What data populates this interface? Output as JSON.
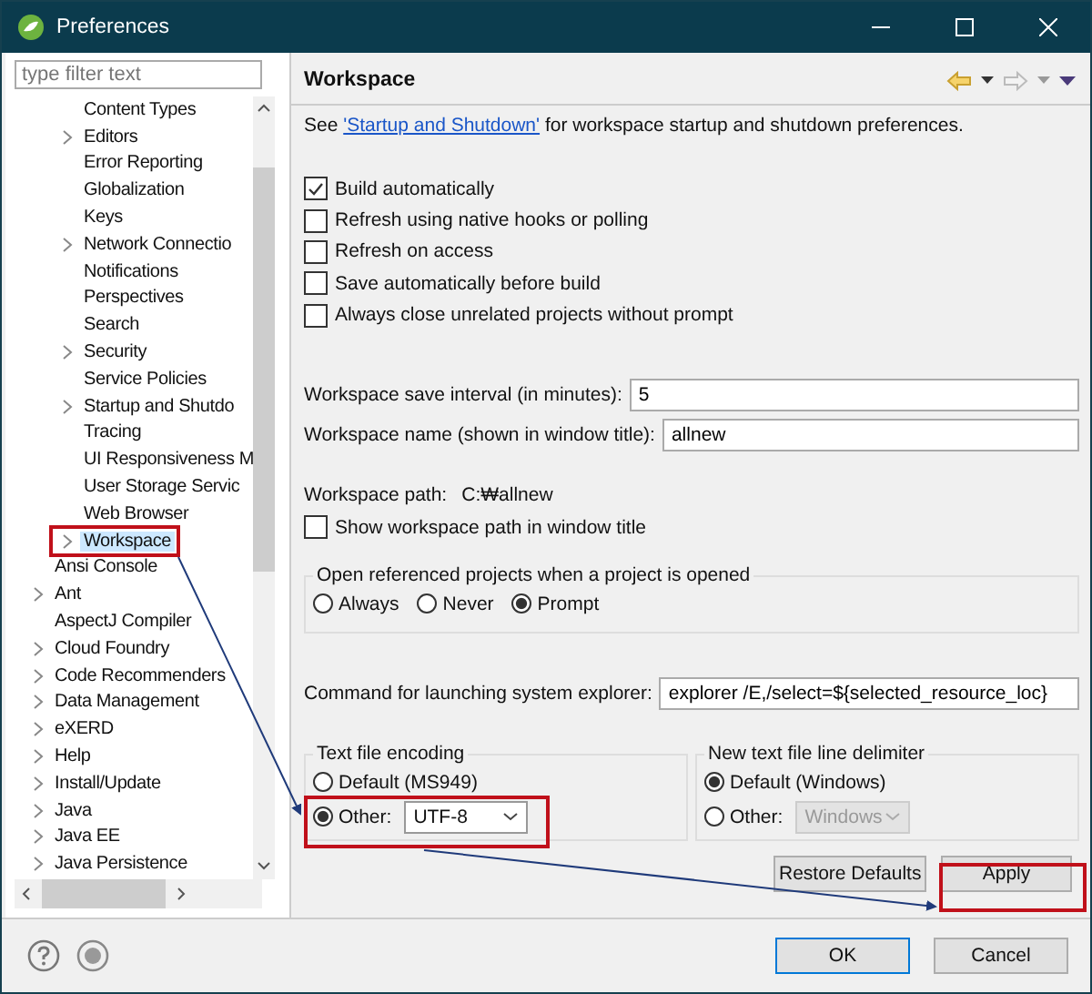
{
  "window": {
    "title": "Preferences"
  },
  "filter": {
    "placeholder": "type filter text"
  },
  "tree": [
    {
      "children": [
        {
          "label": "Content Types",
          "expandable": false,
          "selected": false
        },
        {
          "label": "Editors",
          "expandable": true,
          "selected": false
        },
        {
          "label": "Error Reporting",
          "expandable": false,
          "selected": false
        },
        {
          "label": "Globalization",
          "expandable": false,
          "selected": false
        },
        {
          "label": "Keys",
          "expandable": false,
          "selected": false
        },
        {
          "label": "Network Connectio",
          "expandable": true,
          "selected": false
        },
        {
          "label": "Notifications",
          "expandable": false,
          "selected": false
        },
        {
          "label": "Perspectives",
          "expandable": false,
          "selected": false
        },
        {
          "label": "Search",
          "expandable": false,
          "selected": false
        },
        {
          "label": "Security",
          "expandable": true,
          "selected": false
        },
        {
          "label": "Service Policies",
          "expandable": false,
          "selected": false
        },
        {
          "label": "Startup and Shutdo",
          "expandable": true,
          "selected": false
        },
        {
          "label": "Tracing",
          "expandable": false,
          "selected": false
        },
        {
          "label": "UI Responsiveness M",
          "expandable": false,
          "selected": false
        },
        {
          "label": "User Storage Servic",
          "expandable": false,
          "selected": false
        },
        {
          "label": "Web Browser",
          "expandable": false,
          "selected": false
        },
        {
          "label": "Workspace",
          "expandable": true,
          "selected": true
        }
      ]
    },
    {
      "label": "Ansi Console",
      "expandable": false,
      "selected": false
    },
    {
      "label": "Ant",
      "expandable": true,
      "selected": false
    },
    {
      "label": "AspectJ Compiler",
      "expandable": false,
      "selected": false
    },
    {
      "label": "Cloud Foundry",
      "expandable": true,
      "selected": false
    },
    {
      "label": "Code Recommenders",
      "expandable": true,
      "selected": false
    },
    {
      "label": "Data Management",
      "expandable": true,
      "selected": false
    },
    {
      "label": "eXERD",
      "expandable": true,
      "selected": false
    },
    {
      "label": "Help",
      "expandable": true,
      "selected": false
    },
    {
      "label": "Install/Update",
      "expandable": true,
      "selected": false
    },
    {
      "label": "Java",
      "expandable": true,
      "selected": false
    },
    {
      "label": "Java EE",
      "expandable": true,
      "selected": false
    },
    {
      "label": "Java Persistence",
      "expandable": true,
      "selected": false
    }
  ],
  "page": {
    "title": "Workspace",
    "intro": {
      "before": "See ",
      "link": "'Startup and Shutdown'",
      "after": " for workspace startup and shutdown preferences."
    },
    "checkboxes": [
      {
        "label": "Build automatically",
        "checked": true
      },
      {
        "label": "Refresh using native hooks or polling",
        "checked": false
      },
      {
        "label": "Refresh on access",
        "checked": false
      },
      {
        "label": "Save automatically before build",
        "checked": false
      },
      {
        "label": "Always close unrelated projects without prompt",
        "checked": false
      }
    ],
    "save_interval": {
      "label": "Workspace save interval (in minutes):",
      "value": "5"
    },
    "workspace_name": {
      "label": "Workspace name (shown in window title):",
      "value": "allnew"
    },
    "workspace_path": {
      "label": "Workspace path:",
      "value": "C:₩allnew"
    },
    "show_path": {
      "label": "Show workspace path in window title",
      "checked": false
    },
    "open_referenced": {
      "title": "Open referenced projects when a project is opened",
      "options": [
        {
          "label": "Always",
          "selected": false
        },
        {
          "label": "Never",
          "selected": false
        },
        {
          "label": "Prompt",
          "selected": true
        }
      ]
    },
    "explorer_command": {
      "label": "Command for launching system explorer:",
      "value": "explorer /E,/select=${selected_resource_loc}"
    },
    "encoding": {
      "title": "Text file encoding",
      "default_label": "Default (MS949)",
      "default_selected": false,
      "other_label": "Other:",
      "other_selected": true,
      "other_value": "UTF-8",
      "other_disabled": false
    },
    "line_delimiter": {
      "title": "New text file line delimiter",
      "default_label": "Default (Windows)",
      "default_selected": true,
      "other_label": "Other:",
      "other_selected": false,
      "other_value": "Windows",
      "other_disabled": true
    },
    "buttons": [
      "Restore Defaults",
      "Apply"
    ]
  },
  "footer_buttons": [
    "OK",
    "Cancel"
  ]
}
